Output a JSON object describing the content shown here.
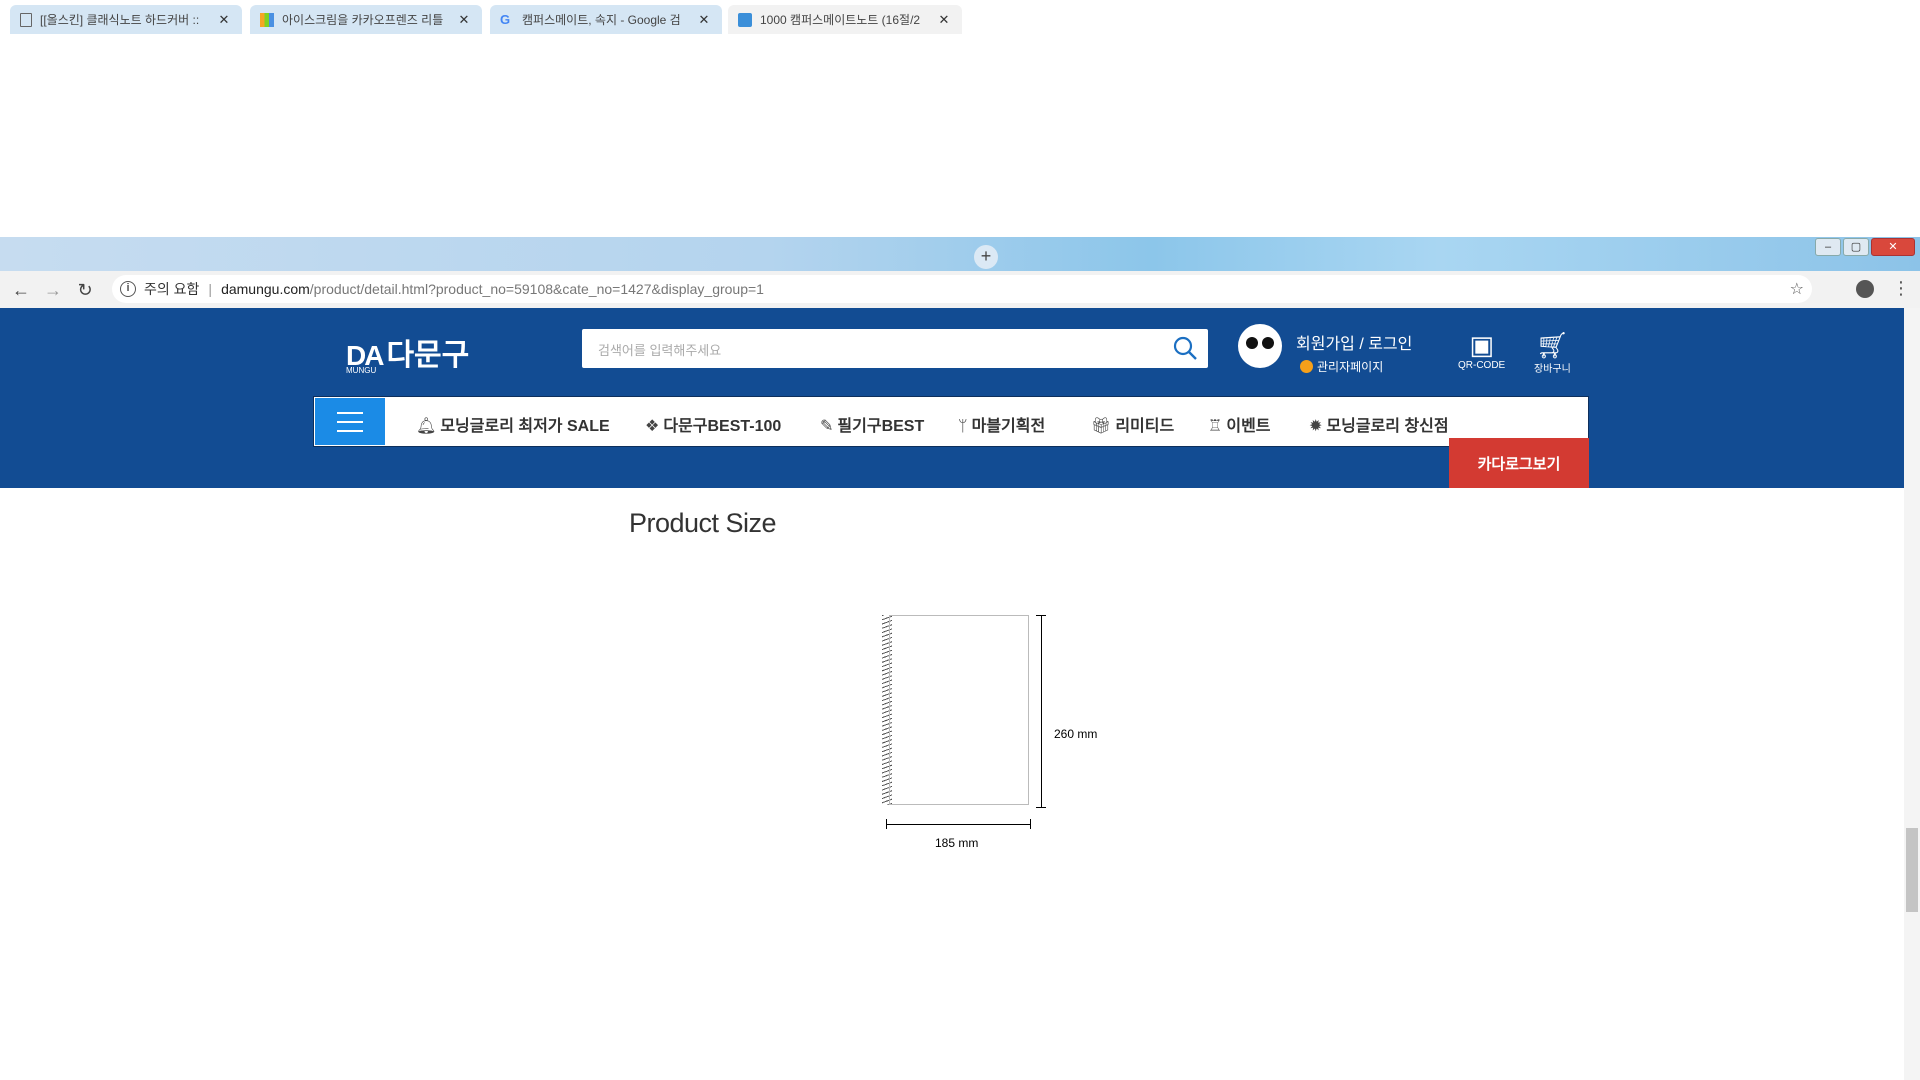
{
  "browser": {
    "tabs": [
      {
        "title": "[[올스킨] 클래식노트 하드커버 ::",
        "active": false
      },
      {
        "title": "아이스크림을 카카오프렌즈 리틀",
        "active": false
      },
      {
        "title": "캠퍼스메이트, 속지 - Google 검",
        "active": false
      },
      {
        "title": "1000 캠퍼스메이트노트 (16절/2",
        "active": true
      }
    ],
    "new_tab": "+",
    "security_label": "주의 요함",
    "url_host": "damungu.com",
    "url_path": "/product/detail.html?product_no=59108&cate_no=1427&display_group=1",
    "window_buttons": {
      "minimize": "–",
      "maximize": "▢",
      "close": "✕"
    }
  },
  "site": {
    "logo_da": "DA",
    "logo_kr": "다문구",
    "logo_sub": "MUNGU",
    "search_placeholder": "검색어를 입력해주세요",
    "login_text": "회원가입 / 로그인",
    "admin_text": "관리자페이지",
    "qr_label": "QR-CODE",
    "cart_label": "장바구니",
    "nav_items": [
      {
        "icon": "bell-icon",
        "label": "모닝글로리 최저가 SALE"
      },
      {
        "icon": "cubes-icon",
        "label": "다문구BEST-100"
      },
      {
        "icon": "pencil-icon",
        "label": "필기구BEST"
      },
      {
        "icon": "branch-icon",
        "label": "마블기획전"
      },
      {
        "icon": "gift-icon",
        "label": "리미티드"
      },
      {
        "icon": "medal-icon",
        "label": "이벤트"
      },
      {
        "icon": "gear-icon",
        "label": "모닝글로리 창신점"
      }
    ],
    "catalog_button": "카다로그보기",
    "colors": {
      "header": "#124c93",
      "menu_button": "#1b8be6",
      "catalog": "#d33a32"
    }
  },
  "content": {
    "section_title": "Product Size",
    "height_label": "260 mm",
    "width_label": "185 mm"
  }
}
